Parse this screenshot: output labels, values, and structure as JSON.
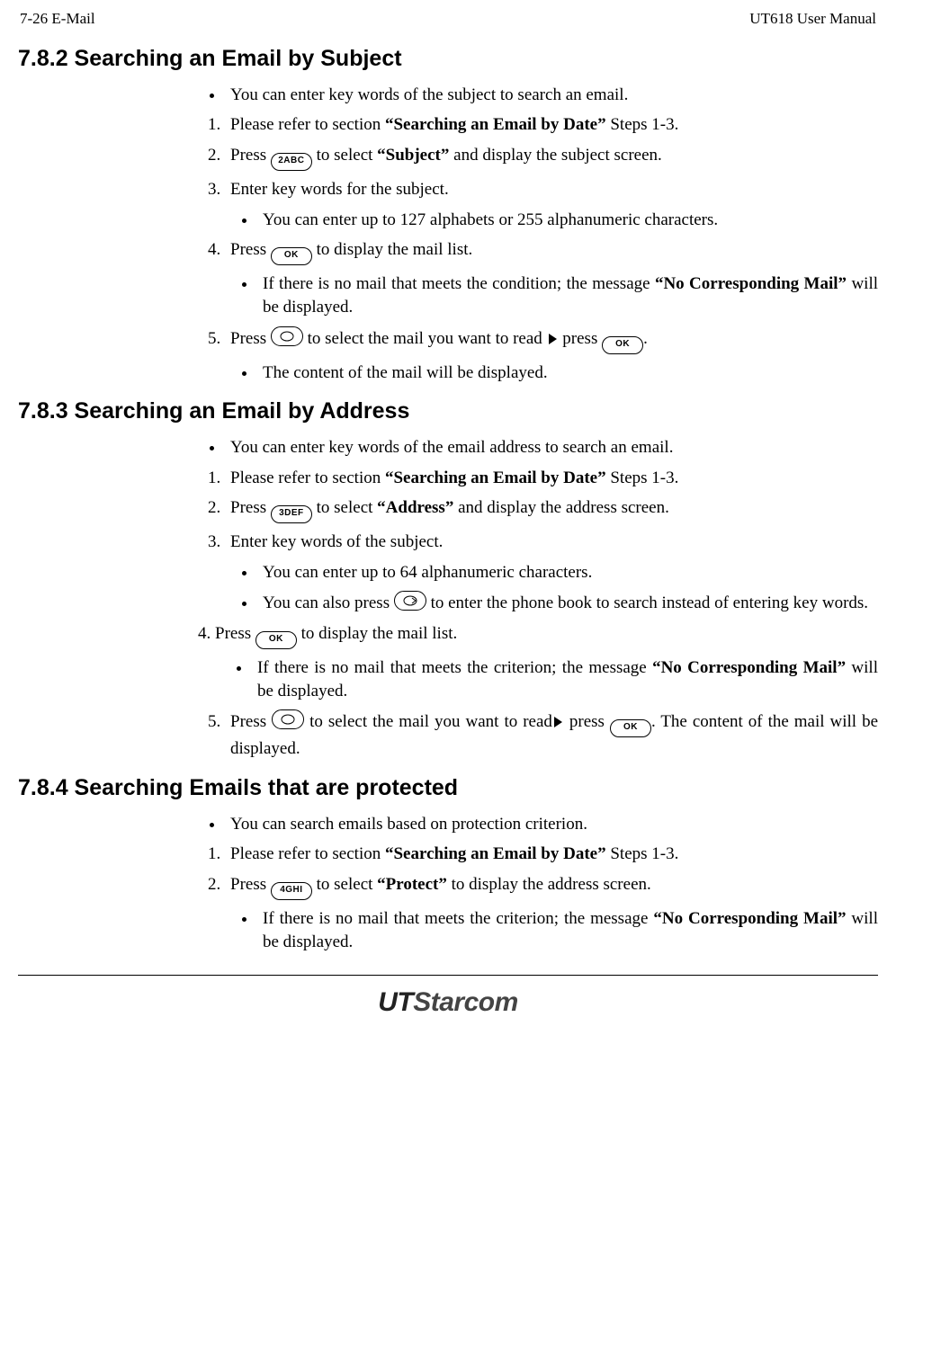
{
  "header": {
    "left": "7-26   E-Mail",
    "right": "UT618 User Manual"
  },
  "sections": {
    "s1": {
      "heading": "7.8.2 Searching an Email by Subject",
      "bullet1": "You can enter key words of the subject to search an email.",
      "li1_a": "Please refer to section ",
      "li1_b": "“Searching an Email by Date”",
      "li1_c": " Steps 1-3.",
      "li2_a": "Press ",
      "li2_key": "2ABC",
      "li2_b": " to select ",
      "li2_c": "“Subject”",
      "li2_d": " and display the subject screen.",
      "li3": "Enter key words for the subject.",
      "li3_sub": "You can enter up to 127 alphabets or 255 alphanumeric characters.",
      "li4_a": "Press ",
      "li4_key": "OK",
      "li4_b": " to display the mail list.",
      "li4_sub_a": "If there is no mail that meets the condition; the message ",
      "li4_sub_b": "“No Corresponding Mail”",
      "li4_sub_c": " will be displayed.",
      "li5_a": "Press ",
      "li5_b": " to select the mail you want to read ",
      "li5_c": " press ",
      "li5_key2": "OK",
      "li5_d": ".",
      "li5_sub": "The content of the mail will be displayed."
    },
    "s2": {
      "heading": "7.8.3 Searching an Email by Address",
      "bullet1": "You can enter key words of the email address to search an email.",
      "li1_a": "Please refer to section ",
      "li1_b": "“Searching an Email by Date”",
      "li1_c": " Steps 1-3.",
      "li2_a": "Press ",
      "li2_key": "3DEF",
      "li2_b": " to select ",
      "li2_c": "“Address”",
      "li2_d": " and display the address screen.",
      "li3": "Enter key words of the subject.",
      "li3_sub1": "You can enter up to 64 alphanumeric characters.",
      "li3_sub2_a": "You can also press ",
      "li3_sub2_b": " to enter the phone book to search instead of entering key words.",
      "li4_a": "4. Press ",
      "li4_key": "OK",
      "li4_b": " to display the mail list.",
      "li4_sub_a": "If there is no mail that meets the criterion; the message ",
      "li4_sub_b": "“No Corresponding Mail”",
      "li4_sub_c": " will be displayed.",
      "li5_a": "Press ",
      "li5_b": " to select the mail you want to read",
      "li5_c": " press ",
      "li5_key2": "OK",
      "li5_d": ". The content of the mail will be displayed."
    },
    "s3": {
      "heading": "7.8.4 Searching Emails that are protected",
      "bullet1": "You can search emails based on protection criterion.",
      "li1_a": "Please refer to section ",
      "li1_b": "“Searching an Email by Date”",
      "li1_c": " Steps 1-3.",
      "li2_a": "Press ",
      "li2_key": "4GHI",
      "li2_b": " to select ",
      "li2_c": "“Protect”",
      "li2_d": " to display the address screen.",
      "li2_sub_a": "If there is no mail that meets the criterion; the message ",
      "li2_sub_b": "“No Corresponding Mail”",
      "li2_sub_c": " will be displayed."
    }
  },
  "footer": {
    "logo1": "UT",
    "logo2": "Starcom"
  }
}
